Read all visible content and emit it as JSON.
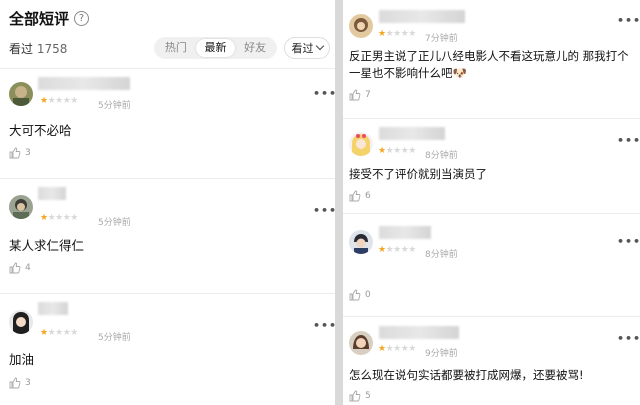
{
  "left": {
    "title": "全部短评",
    "help_glyph": "?",
    "seen_label": "看过",
    "seen_count": "1758",
    "tabs": [
      "热门",
      "最新",
      "好友"
    ],
    "active_tab": "最新",
    "filter_label": "看过",
    "comments": [
      {
        "rating": 1,
        "time": "5分钟前",
        "text": "大可不必哈",
        "likes": "3"
      },
      {
        "rating": 1,
        "time": "5分钟前",
        "text": "某人求仁得仁",
        "likes": "4"
      },
      {
        "rating": 1,
        "time": "5分钟前",
        "text": "加油",
        "likes": "3"
      }
    ]
  },
  "right": {
    "comments": [
      {
        "rating": 1,
        "time": "7分钟前",
        "text_line1": "反正男主说了正儿八经电影人不看这玩意儿的 那我打个",
        "text_line2": "一星也不影响什么吧🐶",
        "likes": "7"
      },
      {
        "rating": 1,
        "time": "8分钟前",
        "text_line1": "接受不了评价就别当演员了",
        "likes": "6"
      },
      {
        "rating": 1,
        "time": "8分钟前",
        "text_line1": "",
        "likes": "0"
      },
      {
        "rating": 1,
        "time": "9分钟前",
        "text_line1": "怎么现在说句实话都要被打成网爆，还要被骂!",
        "likes": "5"
      }
    ]
  },
  "icons": {
    "more": "more-dots-icon",
    "like": "thumbs-up-icon",
    "help": "help-circle-icon",
    "dropdown": "chevron-down-icon"
  },
  "colors": {
    "star": "#f5a623",
    "star_off": "#d9d9d9",
    "muted": "#a9a9a9"
  }
}
